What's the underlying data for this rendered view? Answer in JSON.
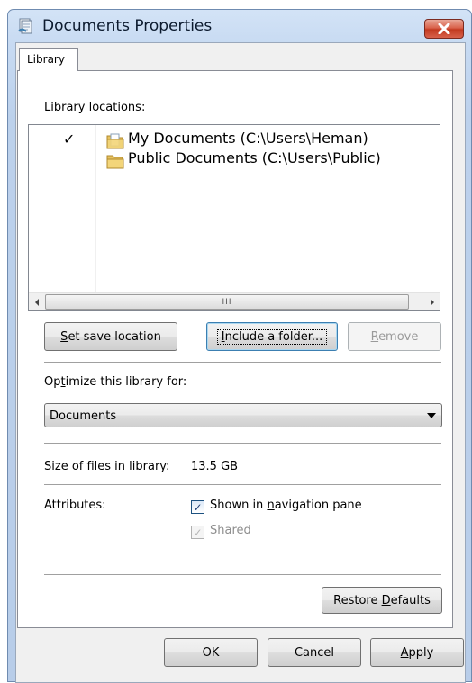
{
  "window": {
    "title": "Documents Properties"
  },
  "tabs": [
    {
      "label": "Library"
    }
  ],
  "library": {
    "locations_label": "Library locations:",
    "locations": [
      {
        "checked": true,
        "name": "My Documents (C:\\Users\\Heman)"
      },
      {
        "checked": false,
        "name": "Public Documents (C:\\Users\\Public)"
      }
    ],
    "scroll_thumb": "III",
    "buttons": {
      "set_save_location": {
        "pre": "",
        "accel": "S",
        "post": "et save location"
      },
      "include_folder": {
        "pre": "",
        "accel": "I",
        "post": "nclude a folder..."
      },
      "remove": {
        "pre": "",
        "accel": "R",
        "post": "emove"
      }
    },
    "optimize": {
      "pre": "Op",
      "accel": "t",
      "post": "imize this library for:",
      "selected": "Documents"
    },
    "size": {
      "label": "Size of files in library:",
      "value": "13.5 GB"
    },
    "attributes": {
      "label": "Attributes:",
      "shown_in_nav": {
        "checked": true,
        "pre": "Shown in ",
        "accel": "n",
        "post": "avigation pane"
      },
      "shared": {
        "checked": true,
        "disabled": true,
        "label": "Shared"
      }
    },
    "restore_defaults": {
      "pre": "Restore ",
      "accel": "D",
      "post": "efaults"
    }
  },
  "footer": {
    "ok": "OK",
    "cancel": "Cancel",
    "apply": {
      "pre": "",
      "accel": "A",
      "post": "pply"
    }
  },
  "colors": {
    "title_bar": "#c7daf2",
    "close": "#c2391f",
    "accent": "#3c7fb1"
  }
}
